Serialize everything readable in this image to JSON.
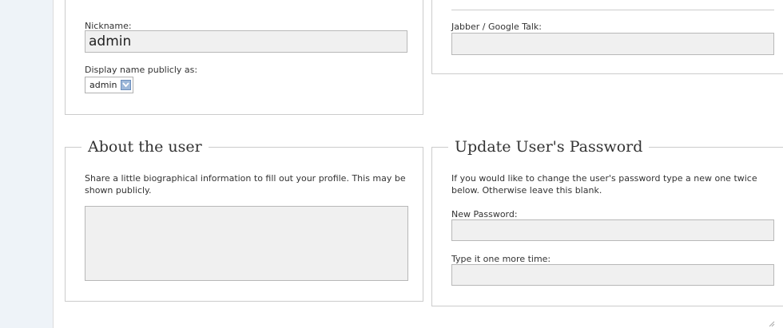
{
  "profile": {
    "nickname_label": "Nickname:",
    "nickname_value": "admin",
    "display_name_label": "Display name publicly as:",
    "display_name_selected": "admin"
  },
  "contact": {
    "jabber_label": "Jabber / Google Talk:",
    "jabber_value": ""
  },
  "about": {
    "legend": "About the user",
    "description": "Share a little biographical information to fill out your profile. This may be shown publicly.",
    "bio_value": ""
  },
  "password": {
    "legend": "Update User's Password",
    "description": "If you would like to change the user's password type a new one twice below. Otherwise leave this blank.",
    "new_label": "New Password:",
    "repeat_label": "Type it one more time:"
  },
  "colors": {
    "field_bg": "#f0f0f0",
    "border": "#cccccc",
    "select_button": "#9db8d9"
  }
}
